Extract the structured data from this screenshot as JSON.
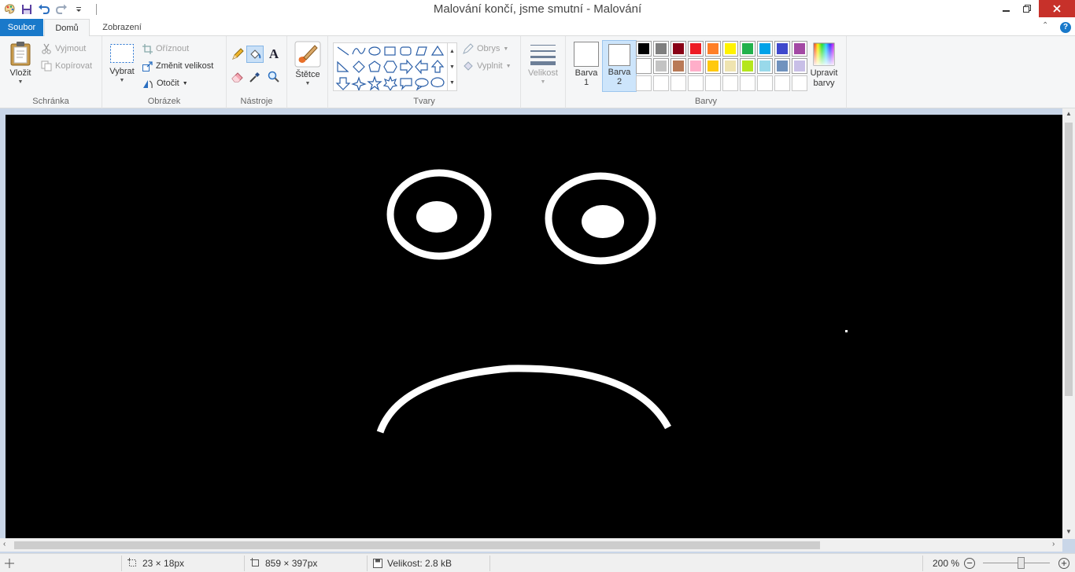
{
  "window": {
    "title": "Malování končí, jsme smutní - Malování",
    "controls": [
      "minimize-icon",
      "restore-icon",
      "close-icon"
    ]
  },
  "quick_access": [
    "paint-app-icon",
    "save-icon",
    "undo-icon",
    "redo-icon",
    "customize-qat-icon"
  ],
  "tabs": {
    "file": "Soubor",
    "home": "Domů",
    "view": "Zobrazení",
    "active": "home"
  },
  "ribbon": {
    "clipboard": {
      "label": "Schránka",
      "paste": "Vložit",
      "cut": "Vyjmout",
      "copy": "Kopírovat"
    },
    "image": {
      "label": "Obrázek",
      "select": "Vybrat",
      "crop": "Oříznout",
      "resize": "Změnit velikost",
      "rotate": "Otočit"
    },
    "tools": {
      "label": "Nástroje",
      "items": [
        "pencil-icon",
        "fill-icon",
        "text-icon",
        "eraser-icon",
        "color-picker-icon",
        "magnifier-icon"
      ],
      "active": "fill-icon"
    },
    "brushes": {
      "label": "Štětce"
    },
    "shapes": {
      "label": "Tvary",
      "outline": "Obrys",
      "fill": "Vyplnit"
    },
    "size": {
      "label": "Velikost"
    },
    "colors": {
      "label": "Barvy",
      "color1": {
        "label_a": "Barva",
        "label_b": "1",
        "value": "#ffffff"
      },
      "color2": {
        "label_a": "Barva",
        "label_b": "2",
        "value": "#ffffff"
      },
      "active": "color2",
      "edit_a": "Upravit",
      "edit_b": "barvy",
      "palette": [
        "#000000",
        "#7f7f7f",
        "#880015",
        "#ed1c24",
        "#ff7f27",
        "#fff200",
        "#22b14c",
        "#00a2e8",
        "#3f48cc",
        "#a349a4",
        "#ffffff",
        "#c3c3c3",
        "#b97a57",
        "#ffaec9",
        "#ffc90e",
        "#efe4b0",
        "#b5e61d",
        "#99d9ea",
        "#7092be",
        "#c8bfe7"
      ],
      "custom_slots": 10
    }
  },
  "canvas": {
    "background": "#000000",
    "stroke": "#ffffff"
  },
  "status": {
    "selection_size": "23 × 18px",
    "image_size": "859 × 397px",
    "file_size": "Velikost: 2.8 kB",
    "zoom": "200 %"
  }
}
